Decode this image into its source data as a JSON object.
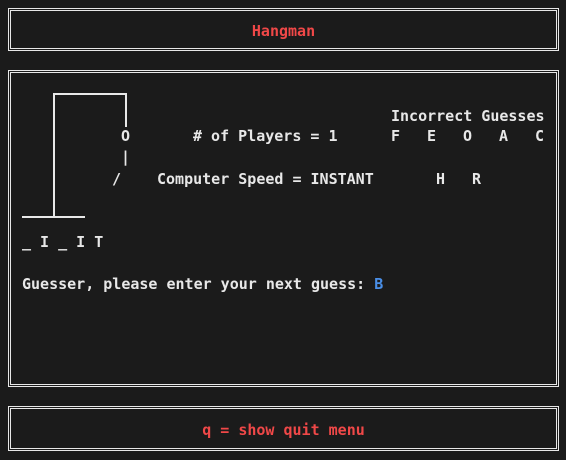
{
  "header": {
    "title": "Hangman"
  },
  "gallows": {
    "head": "O",
    "body": "|",
    "left_arm": "/"
  },
  "info": {
    "players": "# of Players = 1",
    "speed": "Computer Speed = INSTANT"
  },
  "incorrect": {
    "title": "Incorrect Guesses",
    "letters": [
      "F",
      "E",
      "O",
      "A",
      "C",
      "H",
      "R"
    ]
  },
  "word": {
    "pattern": "_ I _ I T"
  },
  "prompt": {
    "text": "Guesser, please enter your next guess: ",
    "value": "B"
  },
  "footer": {
    "hint": "q = show quit menu"
  },
  "colors": {
    "title": "#f04848",
    "guess_input": "#4a8fe8",
    "text": "#e8e8e8",
    "background": "#1b1b1b"
  }
}
